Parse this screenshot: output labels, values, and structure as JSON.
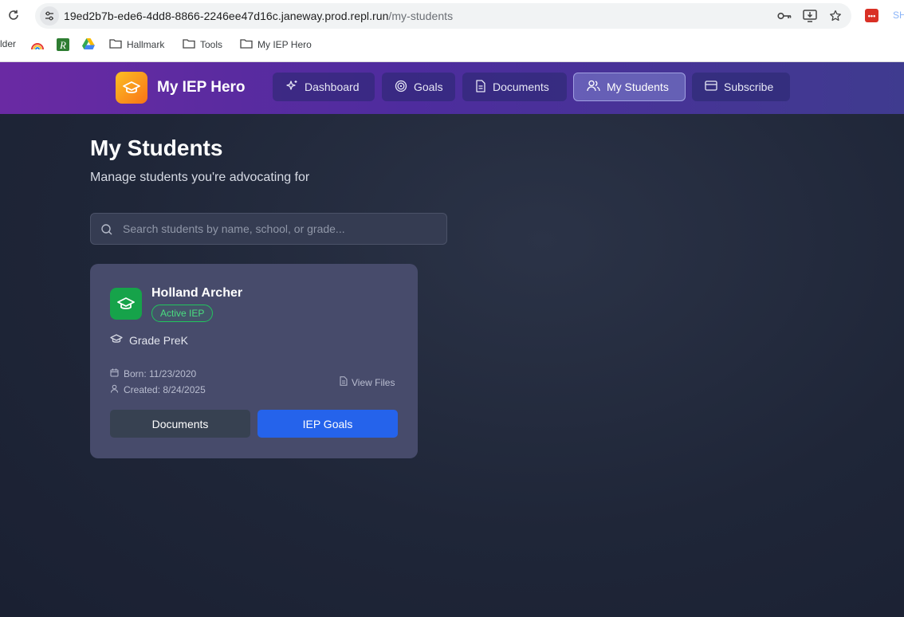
{
  "browser": {
    "url_host": "19ed2b7b-ede6-4dd8-8866-2246ee47d16c.janeway.prod.repl.run",
    "url_path": "/my-students",
    "profile_label": "SH",
    "bookmarks": [
      {
        "label": "lder",
        "icon": "folder-icon"
      },
      {
        "label": "",
        "icon": "rainbow-icon"
      },
      {
        "label": "",
        "icon": "r-logo-icon"
      },
      {
        "label": "",
        "icon": "google-drive-icon"
      },
      {
        "label": "Hallmark",
        "icon": "folder-icon"
      },
      {
        "label": "Tools",
        "icon": "folder-icon"
      },
      {
        "label": "My IEP Hero",
        "icon": "folder-icon"
      }
    ]
  },
  "app": {
    "brand": "My IEP Hero",
    "nav": [
      {
        "label": "Dashboard",
        "icon": "sparkle-icon",
        "active": false
      },
      {
        "label": "Goals",
        "icon": "target-icon",
        "active": false
      },
      {
        "label": "Documents",
        "icon": "document-icon",
        "active": false
      },
      {
        "label": "My Students",
        "icon": "users-icon",
        "active": true
      },
      {
        "label": "Subscribe",
        "icon": "credit-card-icon",
        "active": false
      }
    ]
  },
  "page": {
    "title": "My Students",
    "subtitle": "Manage students you're advocating for",
    "search_placeholder": "Search students by name, school, or grade..."
  },
  "students": [
    {
      "name": "Holland Archer",
      "badge": "Active IEP",
      "grade": "Grade PreK",
      "born": "Born: 11/23/2020",
      "created": "Created: 8/24/2025",
      "view_files": "View Files",
      "documents_label": "Documents",
      "goals_label": "IEP Goals"
    }
  ],
  "colors": {
    "header_gradient_start": "#6a2aa3",
    "header_gradient_end": "#3f3b8f",
    "logo_gradient": "#f97316",
    "student_avatar": "#16a34a",
    "badge_green": "#22c55e",
    "primary_button": "#2563eb",
    "secondary_button": "#374151"
  }
}
